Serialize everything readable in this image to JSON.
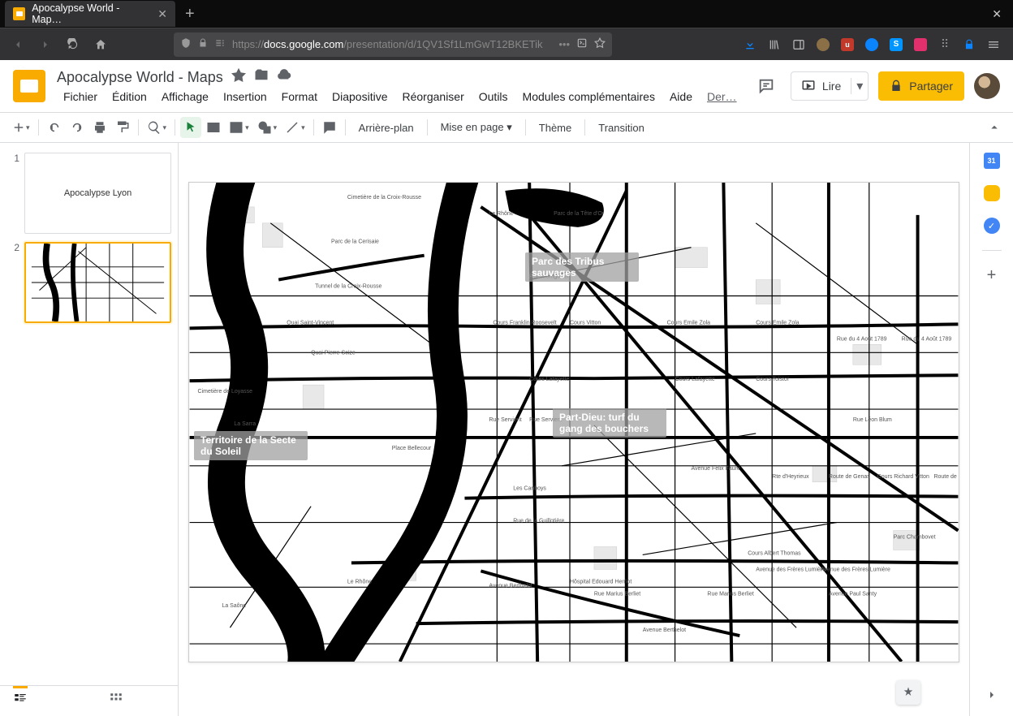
{
  "browser": {
    "tab_title": "Apocalypse World - Map…",
    "url_proto": "https://",
    "url_host": "docs.google.com",
    "url_path": "/presentation/d/1QV1Sf1LmGwT12BKETik"
  },
  "app": {
    "doc_title": "Apocalypse World - Maps",
    "present_label": "Lire",
    "share_label": "Partager",
    "last_edit": "Der…"
  },
  "menubar": {
    "file": "Fichier",
    "edit": "Édition",
    "view": "Affichage",
    "insert": "Insertion",
    "format": "Format",
    "slide": "Diapositive",
    "arrange": "Réorganiser",
    "tools": "Outils",
    "addons": "Modules complémentaires",
    "help": "Aide"
  },
  "toolbar": {
    "background": "Arrière-plan",
    "layout": "Mise en page",
    "theme": "Thème",
    "transition": "Transition"
  },
  "slides": {
    "s1_num": "1",
    "s1_title": "Apocalypse Lyon",
    "s2_num": "2"
  },
  "map_labels": {
    "parc": "Parc des Tribus sauvages",
    "partdieu": "Part-Dieu: turf du gang des bouchers",
    "territoire": "Territoire de la Secte du Soleil"
  },
  "sidepanel": {
    "calendar": "31"
  }
}
